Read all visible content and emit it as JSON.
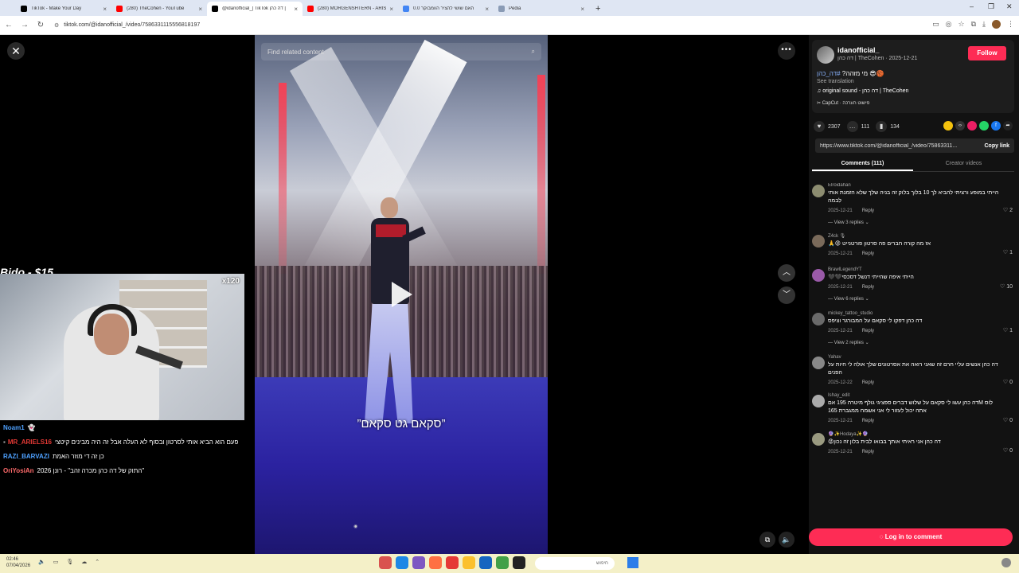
{
  "browser": {
    "tabs": [
      {
        "title": "TikTok - Make Your Day",
        "color": "#000000",
        "active": false
      },
      {
        "title": "(280) TheCohen - YouTube",
        "color": "#ff0000",
        "active": false
      },
      {
        "title": "@idanofficial_| TikTok דה כהן |",
        "color": "#000000",
        "active": true
      },
      {
        "title": "(280) MORGENSHTERN - ARISTOCRAT",
        "color": "#ff0000",
        "active": false
      },
      {
        "title": "האם שושי להציר הוומבוקר 0.0",
        "color": "#4285f4",
        "active": false
      },
      {
        "title": "Pedia",
        "color": "#8a9bb5",
        "active": false
      }
    ],
    "url": "tiktok.com/@idanofficial_/video/7586331115556818197"
  },
  "video": {
    "search_placeholder": "Find related content",
    "caption": "”סקאם גט סקאם”"
  },
  "stream": {
    "cam_label": "Bido - $15",
    "cam_badge": "x120",
    "chat": [
      {
        "user": "Noam1",
        "message": "",
        "color": "#4ea1ff"
      },
      {
        "user": "MR_ARIELS16",
        "message": "פעם הוא הביא אותי לסרטון ובסוף לא העלה אבל זה היה מבינים קיטצי",
        "color": "#e53935"
      },
      {
        "user": "RAZI_BARVAZI",
        "message": "כן זה די מוזר האמת",
        "color": "#4ea1ff"
      },
      {
        "user": "OriYosiAn",
        "message": "התוק של דה כהן מכרה זהב\" - רונן 2026\"",
        "color": "#ff6b6b"
      }
    ]
  },
  "post": {
    "username": "idanofficial_",
    "subline": "דה כהן | TheCohen · 2025-12-21",
    "follow_label": "Follow",
    "description_prefix": "מי מזהה?",
    "description_tag": "#דה_כהן",
    "see_translation": "See translation",
    "sound": "original sound - דה כהן | TheCohen",
    "capcut": "CapCut · פישוט הערכה",
    "likes": "2307",
    "comments": "111",
    "saves": "134",
    "link": "https://www.tiktok.com/@idanofficial_/video/75863311...",
    "copy_link": "Copy link",
    "tab_comments": "Comments (111)",
    "tab_videos": "Creator videos",
    "login_label": "Log in to comment",
    "share_colors": [
      "#f4c20d",
      "#333333",
      "#e91e63",
      "#25d366",
      "#1877f2",
      "#222222"
    ]
  },
  "comments": [
    {
      "name": "Elroidahan",
      "text": "הייתי במופע ורציתי להביא לך 10 בלוך בלוק זה בניה שלך שלא הזמנת אותי לבמה",
      "date": "2025-12-21",
      "reply": "Reply",
      "likes": "2",
      "replies": "View 3 replies"
    },
    {
      "name": "Z4ck 🎙",
      "text": "אז מה קורה חברים פה סרטון פורטנייט 😡🙏",
      "date": "2025-12-21",
      "reply": "Reply",
      "likes": "1",
      "replies": ""
    },
    {
      "name": "BrawlLegendYT",
      "text": "הייתי איפה שהייתי דנשל דסכסי🖤🖤",
      "date": "2025-12-21",
      "reply": "Reply",
      "likes": "10",
      "replies": "View 6 replies"
    },
    {
      "name": "mickey_tattoo_studio",
      "text": "דה כהן דפקו לי סקאם על המבורגר וציפס",
      "date": "2025-12-21",
      "reply": "Reply",
      "likes": "1",
      "replies": "View 2 replies"
    },
    {
      "name": "Yahav",
      "text": "דה כהן אנשים עליי חרם זה שאני רואה את אסרטונים שלך אולה לי חיות על הפנים",
      "date": "2025-12-22",
      "reply": "Reply",
      "likes": "0",
      "replies": ""
    },
    {
      "name": "Ishay_edit",
      "text": "לוס Mדה כהן עשו לי סקאם על שלוש דברים ספציגי גולף מיטרה 195 אם אתה יכול לעזור לי אני אשמח ממגברת 165",
      "date": "2025-12-21",
      "reply": "Reply",
      "likes": "0",
      "replies": ""
    },
    {
      "name": "🔮✨Hodaya✨🔮",
      "text": "דה כהן אני ראיתי אותך בבואו לבית בלון זה נכון😡",
      "date": "2025-12-21",
      "reply": "Reply",
      "likes": "0",
      "replies": ""
    }
  ],
  "taskbar": {
    "time": "02:46",
    "date": "07/04/2026",
    "search_placeholder": "חיפוש",
    "app_colors": [
      "#d9534f",
      "#1e88e5",
      "#7e57c2",
      "#ff7043",
      "#e53935",
      "#fbc02d",
      "#1565c0",
      "#43a047",
      "#222222"
    ]
  }
}
